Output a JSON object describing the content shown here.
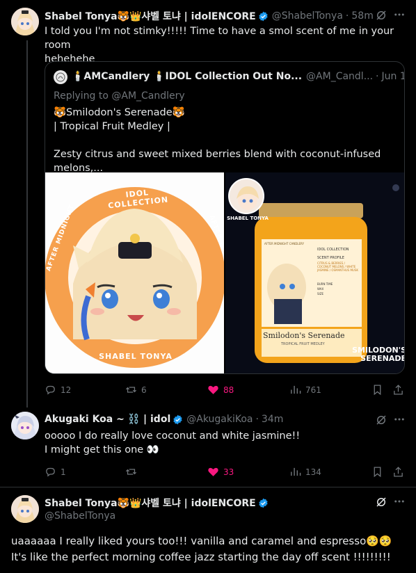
{
  "tweet1": {
    "name": "Shabel Tonya🐯👑샤벨 토냐 | idolENCORE",
    "handle": "@ShabelTonya",
    "time": "58m",
    "text_line1": "I told you I'm not stimky!!!!! Time to have a smol scent of me in your room",
    "text_line2": "hehehehe",
    "quote": {
      "name": "🕯️AMCandlery 🕯️IDOL Collection Out No...",
      "handle": "@AM_Candl...",
      "time": "Jun 1",
      "replying": "Replying to @AM_Candlery",
      "title": "🐯Smilodon's Serenade🐯",
      "subtitle": "| Tropical Fruit Medley |",
      "body": "Zesty citrus and sweet mixed berries blend with coconut-infused melons,...",
      "badge_text": "IDOL COLLECTION",
      "badge_left": "AFTER MIDNIGHT",
      "badge_right": "AFTER MIDNIGHT",
      "badge_bottom": "SHABEL TONYA",
      "sticker_text": "SHABEL TONYA",
      "jar_brand": "AFTER MIDNIGHT CANDLERY",
      "jar_title": "Smilodon's Serenade",
      "jar_sub": "TROPICAL FRUIT MEDLEY",
      "label_idol": "IDOL COLLECTION",
      "label_profile": "SCENT PROFILE",
      "label_notes": "CITRUS & BERRIES / COCONUT MELONS / WHITE JASMINE / OSMANTHUS MUSK",
      "label_burn": "BURN TIME",
      "label_wax": "WAX",
      "label_size": "SIZE",
      "product_caption_1": "SMILODON'S",
      "product_caption_2": "SERENADE"
    },
    "replies": "12",
    "reposts": "6",
    "likes": "88",
    "views": "761"
  },
  "tweet2": {
    "name": "Akugaki Koa ~ ⛓️ | idol",
    "handle": "@AkugakiKoa",
    "time": "34m",
    "text_line1": "ooooo I do really love coconut and white jasmine!!",
    "text_line2": "I might get this one 👀",
    "replies": "1",
    "reposts": "",
    "likes": "33",
    "views": "134"
  },
  "tweet3": {
    "name": "Shabel Tonya🐯👑샤벨 토냐 | idolENCORE",
    "handle": "@ShabelTonya",
    "text_line1": "uaaaaaa I really liked yours too!!! vanilla and caramel and espresso🥺🥺",
    "text_line2": "It's like the perfect morning coffee jazz starting the day off scent !!!!!!!!!"
  },
  "colors": {
    "background": "#000000",
    "text": "#e7e9ea",
    "muted": "#71767b",
    "like": "#f91880",
    "verified": "#1d9bf0",
    "candle": "#f3a41b",
    "badge_orange": "#f6a04d"
  }
}
